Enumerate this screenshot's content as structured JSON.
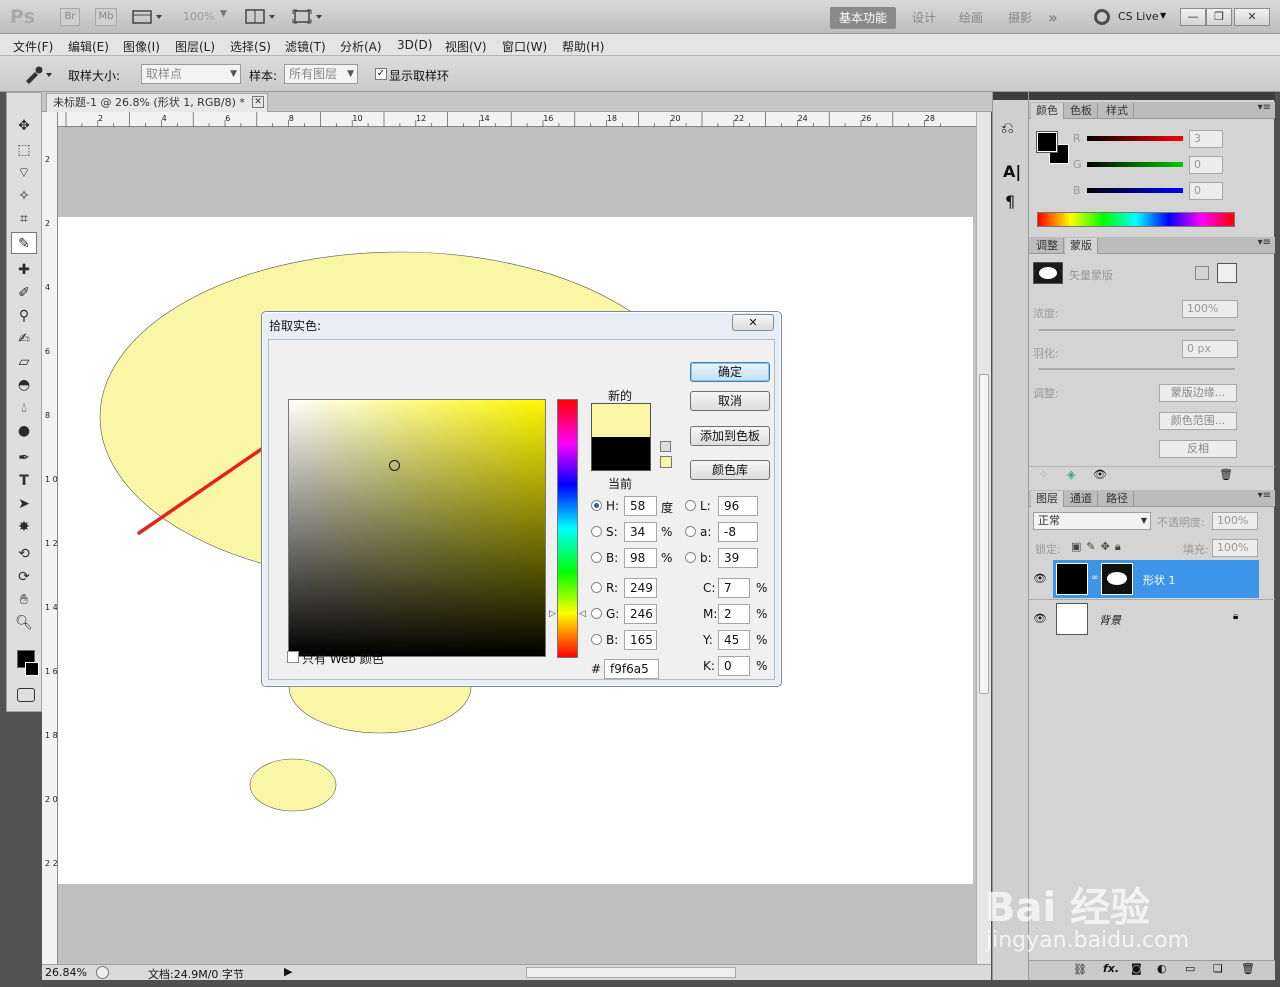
{
  "app": {
    "logo": "Ps",
    "bridge_btn": "Br",
    "minibridge_btn": "Mb",
    "zoom": "100%",
    "workspaces": [
      "基本功能",
      "设计",
      "绘画",
      "摄影"
    ],
    "more_workspaces": "»",
    "cslive": "CS Live",
    "window_buttons": [
      "—",
      "❐",
      "✕"
    ]
  },
  "menu": [
    "文件(F)",
    "编辑(E)",
    "图像(I)",
    "图层(L)",
    "选择(S)",
    "滤镜(T)",
    "分析(A)",
    "3D(D)",
    "视图(V)",
    "窗口(W)",
    "帮助(H)"
  ],
  "options": {
    "sample_size_label": "取样大小:",
    "sample_size_value": "取样点",
    "sample_label": "样本:",
    "sample_value": "所有图层",
    "show_ring_label": "显示取样环"
  },
  "document": {
    "tab_title": "未标题-1 @ 26.8% (形状 1, RGB/8) *",
    "ruler_top": [
      "2",
      "4",
      "6",
      "8",
      "10",
      "12",
      "14",
      "16",
      "18",
      "20",
      "22",
      "24",
      "26",
      "28"
    ],
    "ruler_left": [
      "2",
      "2",
      "4",
      "6",
      "8",
      "1 0",
      "1 2",
      "1 4",
      "1 6",
      "1 8",
      "2 0",
      "2 2"
    ],
    "zoom": "26.84%",
    "doc_info": "文档:24.9M/0 字节"
  },
  "color_picker": {
    "title": "拾取实色:",
    "close": "✕",
    "ok": "确定",
    "cancel": "取消",
    "add_to_swatches": "添加到色板",
    "color_libraries": "颜色库",
    "new_label": "新的",
    "current_label": "当前",
    "new_color": "#f9f6a5",
    "current_color": "#000000",
    "hsb": {
      "H": "58",
      "S": "34",
      "B": "98",
      "h_unit": "度",
      "pct": "%"
    },
    "lab": {
      "L": "96",
      "a": "-8",
      "b": "39"
    },
    "rgb": {
      "R": "249",
      "G": "246",
      "B": "165"
    },
    "cmyk": {
      "C": "7",
      "M": "2",
      "Y": "45",
      "K": "0",
      "pct": "%"
    },
    "hex_label": "#",
    "hex": "f9f6a5",
    "web_only": "只有 Web 颜色",
    "labels": {
      "H": "H:",
      "S": "S:",
      "B": "B:",
      "L": "L:",
      "a": "a:",
      "b": "b:",
      "R": "R:",
      "G": "G:",
      "Bl": "B:",
      "C": "C:",
      "M": "M:",
      "Y": "Y:",
      "K": "K:"
    }
  },
  "panels": {
    "color_tabs": [
      "颜色",
      "色板",
      "样式"
    ],
    "rgb_labels": [
      "R",
      "G",
      "B"
    ],
    "rgb_values": [
      "3",
      "0",
      "0"
    ],
    "adjust_tabs": [
      "调整",
      "蒙版"
    ],
    "vector_mask": "矢量蒙版",
    "density_label": "浓度:",
    "density_value": "100%",
    "feather_label": "羽化:",
    "feather_value": "0 px",
    "adjust_label": "调整:",
    "mask_edge": "蒙版边缘...",
    "color_range": "颜色范围...",
    "invert": "反相",
    "layers_tabs": [
      "图层",
      "通道",
      "路径"
    ],
    "blend_mode": "正常",
    "opacity_label": "不透明度:",
    "opacity_value": "100%",
    "lock_label": "锁定:",
    "fill_label": "填充:",
    "fill_value": "100%",
    "layers": [
      {
        "name": "形状 1",
        "selected": true
      },
      {
        "name": "背景",
        "selected": false
      }
    ]
  },
  "watermark": {
    "line1": "Bai 经验",
    "line2": "jingyan.baidu.com"
  },
  "colors": {
    "shape_fill": "#f9f6a5",
    "arrow": "#e8201e",
    "selection": "#3d95ea"
  }
}
